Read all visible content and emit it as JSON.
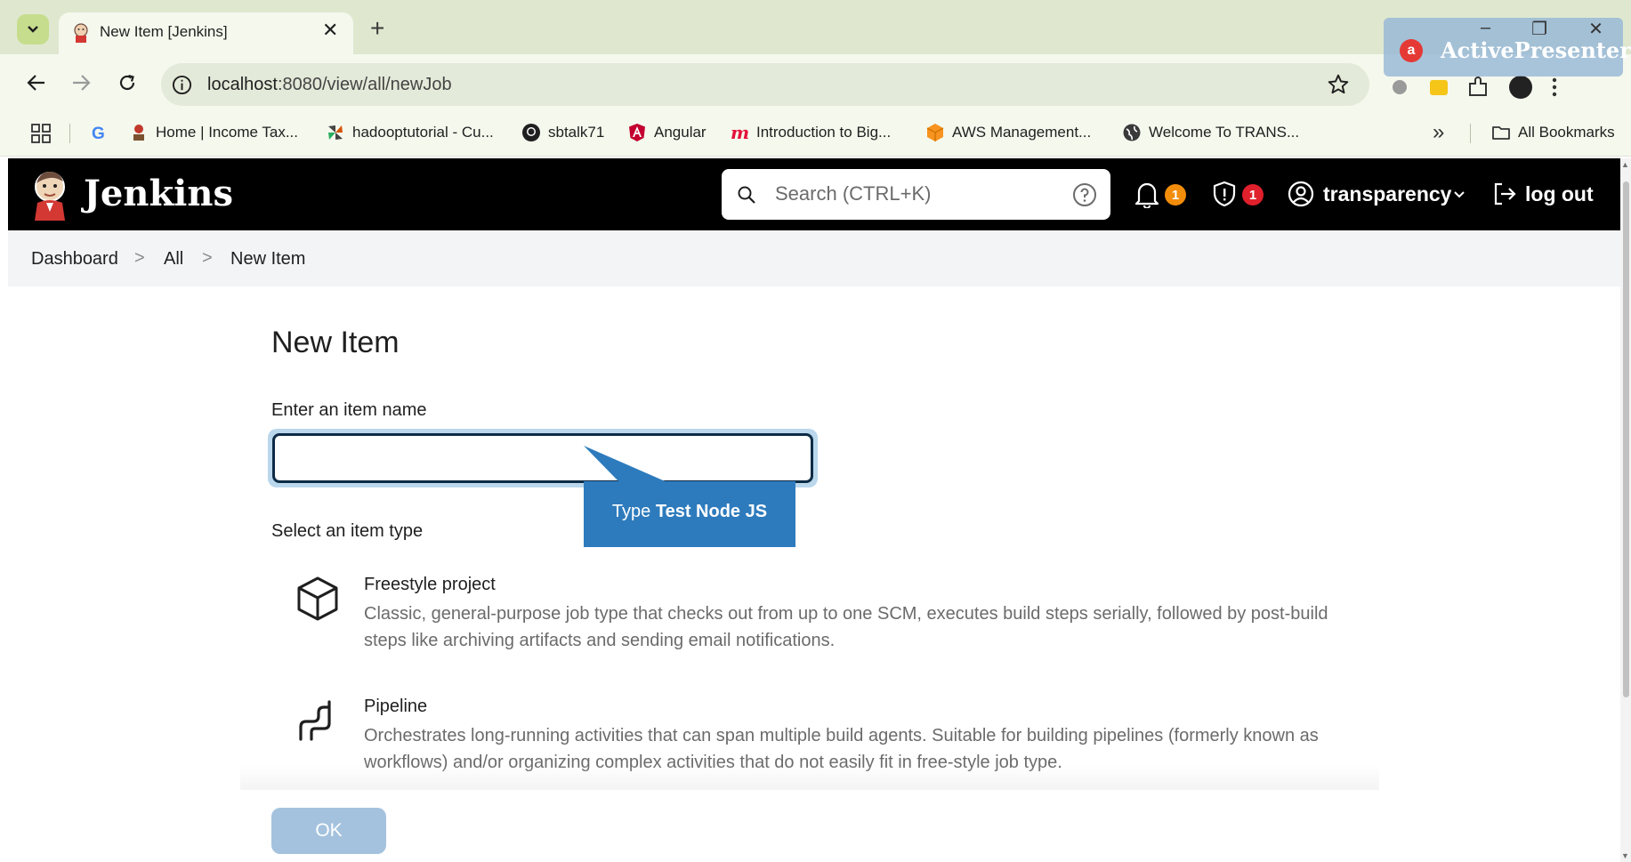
{
  "browser": {
    "tab_title": "New Item [Jenkins]",
    "close_glyph": "✕",
    "new_tab_glyph": "+",
    "url_host": "localhost",
    "url_path": ":8080/view/all/newJob",
    "bookmarks": [
      {
        "label": "",
        "icon": "google-icon"
      },
      {
        "label": "Home | Income Tax...",
        "icon": "income-tax-icon"
      },
      {
        "label": "hadooptutorial - Cu...",
        "icon": "pinwheel-icon"
      },
      {
        "label": "sbtalk71",
        "icon": "github-icon"
      },
      {
        "label": "Angular",
        "icon": "angular-icon"
      },
      {
        "label": "Introduction to Big...",
        "icon": "m-logo-icon"
      },
      {
        "label": "AWS Management...",
        "icon": "aws-cube-icon"
      },
      {
        "label": "Welcome To TRANS...",
        "icon": "globe-icon"
      }
    ],
    "more_bookmarks_glyph": "»",
    "all_bookmarks": "All Bookmarks"
  },
  "overlay": {
    "app_name": "ActivePresenter",
    "controls": [
      "–",
      "❐",
      "✕"
    ]
  },
  "jenkins": {
    "brand": "Jenkins",
    "search_placeholder": "Search (CTRL+K)",
    "notifications_count": "1",
    "security_count": "1",
    "username": "transparency",
    "logout_label": "log out"
  },
  "breadcrumb": {
    "items": [
      "Dashboard",
      "All",
      "New Item"
    ],
    "separator": ">"
  },
  "main": {
    "title": "New Item",
    "name_label": "Enter an item name",
    "name_value": "",
    "type_label": "Select an item type",
    "item_types": [
      {
        "name": "Freestyle project",
        "description": "Classic, general-purpose job type that checks out from up to one SCM, executes build steps serially, followed by post-build steps like archiving artifacts and sending email notifications.",
        "icon": "cube-icon"
      },
      {
        "name": "Pipeline",
        "description": "Orchestrates long-running activities that can span multiple build agents. Suitable for building pipelines (formerly known as workflows) and/or organizing complex activities that do not easily fit in free-style job type.",
        "icon": "pipeline-icon"
      }
    ],
    "ok_label": "OK"
  },
  "callout": {
    "prefix": "Type",
    "emphasis": "Test Node JS"
  },
  "colors": {
    "jenkins_header": "#000000",
    "callout": "#2d7bbd",
    "ok_button": "#a4c2de",
    "badge_orange": "#f28c0b",
    "badge_red": "#e0202c"
  }
}
